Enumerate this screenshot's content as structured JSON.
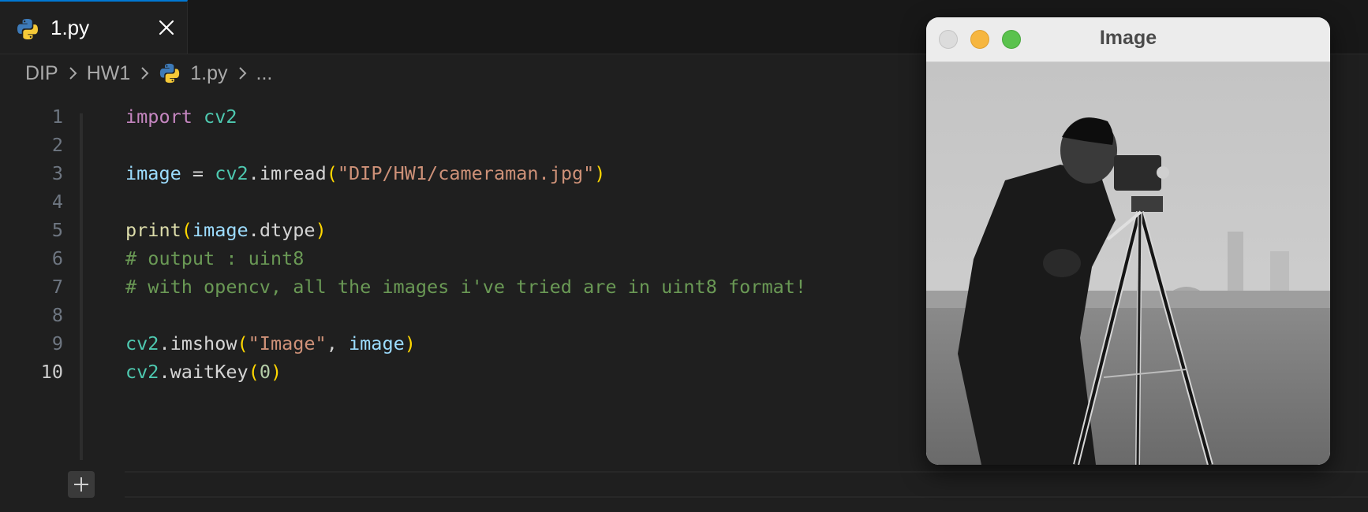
{
  "tab": {
    "filename": "1.py"
  },
  "breadcrumb": {
    "items": [
      "DIP",
      "HW1",
      "1.py",
      "..."
    ]
  },
  "editor": {
    "active_line": 10,
    "lines": [
      {
        "number": "1",
        "text": "import cv2"
      },
      {
        "number": "2",
        "text": ""
      },
      {
        "number": "3",
        "text": "image = cv2.imread(\"DIP/HW1/cameraman.jpg\")"
      },
      {
        "number": "4",
        "text": ""
      },
      {
        "number": "5",
        "text": "print(image.dtype)"
      },
      {
        "number": "6",
        "text": "# output : uint8"
      },
      {
        "number": "7",
        "text": "# with opencv, all the images i've tried are in uint8 format!"
      },
      {
        "number": "8",
        "text": ""
      },
      {
        "number": "9",
        "text": "cv2.imshow(\"Image\", image)"
      },
      {
        "number": "10",
        "text": "cv2.waitKey(0)"
      }
    ]
  },
  "image_window": {
    "title": "Image"
  },
  "colors": {
    "accent": "#0078d4",
    "keyword": "#c586c0",
    "module": "#4ec9b0",
    "variable": "#9cdcfe",
    "function": "#dcdcaa",
    "string": "#ce9178",
    "number": "#b5cea8",
    "comment": "#6a9955",
    "bracket": "#ffd700"
  },
  "icons": [
    "python-icon",
    "close-icon",
    "chevron-right-icon",
    "plus-icon"
  ]
}
